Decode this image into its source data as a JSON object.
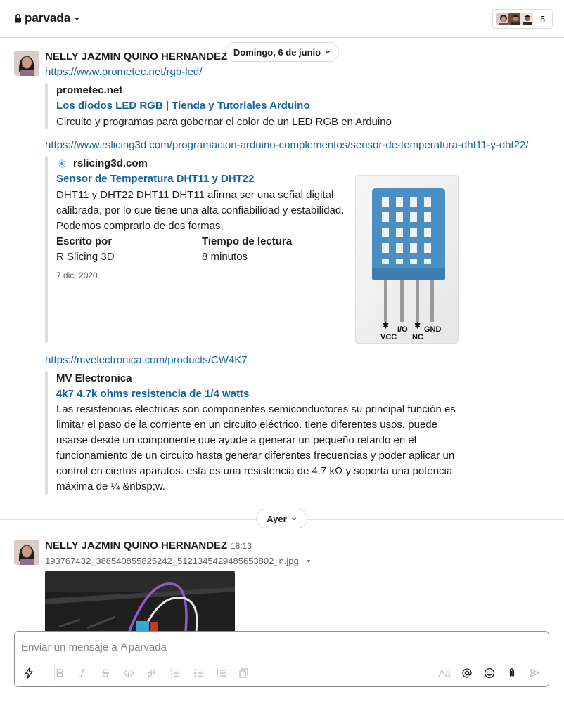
{
  "header": {
    "channel_name": "parvada",
    "member_count": "5"
  },
  "day_dividers": {
    "first": "Domingo, 6 de junio",
    "second": "Ayer"
  },
  "message1": {
    "author": "NELLY JAZMIN QUINO HERNANDEZ",
    "link1": "https://www.prometec.net/rgb-led/",
    "unfurl1": {
      "site": "prometec.net",
      "title": "Los diodos LED RGB | Tienda y Tutoriales Arduino",
      "description": "Circuito y programas para gobernar el color de un LED RGB en Arduino"
    },
    "link2": "https://www.rslicing3d.com/programacion-arduino-complementos/sensor-de-temperatura-dht11-y-dht22/",
    "unfurl2": {
      "site": "rslicing3d.com",
      "title": "Sensor de Temperatura DHT11 y DHT22",
      "description_lines": [
        "DHT11 y DHT22 DHT11 DHT11 afirma ser una señal digital",
        "calibrada, por lo que tiene una alta confiabilidad y estabilidad.",
        "Podemos comprarlo de dos formas,"
      ],
      "field1_label": "Escrito por",
      "field1_value": "R Slicing 3D",
      "field2_label": "Tiempo de lectura",
      "field2_value": "8 minutos",
      "date": "7 dic. 2020",
      "image_labels": {
        "vcc": "VCC",
        "io": "I/O",
        "nc": "NC",
        "gnd": "GND"
      }
    },
    "link3": "https://mvelectronica.com/products/CW4K7",
    "unfurl3": {
      "site": "MV Electronica",
      "title": "4k7 4.7k ohms resistencia de 1/4 watts",
      "description_lines": [
        "Las resistencias eléctricas son componentes semiconductores su principal función es",
        "limitar el paso de la corriente en un circuito eléctrico. tiene diferentes usos, puede",
        "usarse desde un componente que ayude a generar un pequeño retardo en el",
        "funcionamiento de un circuito hasta generar diferentes frecuencias y poder aplicar un",
        "control en ciertos aparatos. esta es una resistencia de 4.7 kΩ y soporta una potencia",
        "máxima de ¼ &nbsp;w."
      ]
    }
  },
  "message2": {
    "author": "NELLY JAZMIN QUINO HERNANDEZ",
    "time": "18:13",
    "file_name": "193767432_388540855825242_5121345429485653802_n.jpg"
  },
  "composer": {
    "placeholder_prefix": "Enviar un mensaje a",
    "placeholder_channel": "parvada",
    "format_label": "Aa"
  },
  "colors": {
    "link": "#1264a3",
    "text": "#1d1c1d",
    "muted": "#616061",
    "border": "#dddddd",
    "sensor_blue": "#4a8fc4"
  }
}
